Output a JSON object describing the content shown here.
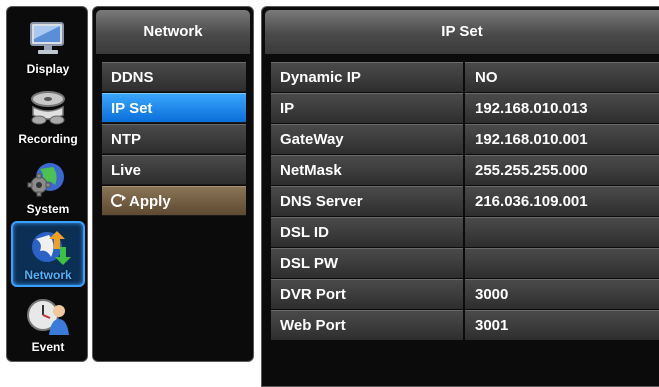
{
  "sidebar": {
    "items": [
      {
        "label": "Display",
        "icon": "monitor-icon"
      },
      {
        "label": "Recording",
        "icon": "film-reel-icon"
      },
      {
        "label": "System",
        "icon": "gear-globe-icon"
      },
      {
        "label": "Network",
        "icon": "network-globe-icon",
        "active": true
      },
      {
        "label": "Event",
        "icon": "clock-person-icon"
      }
    ]
  },
  "menu": {
    "title": "Network",
    "items": [
      {
        "label": "DDNS"
      },
      {
        "label": "IP Set",
        "selected": true
      },
      {
        "label": "NTP"
      },
      {
        "label": "Live"
      },
      {
        "label": "Apply",
        "icon": "refresh-icon"
      }
    ]
  },
  "ipset": {
    "title": "IP Set",
    "rows": [
      {
        "label": "Dynamic IP",
        "value": "NO"
      },
      {
        "label": "IP",
        "value": "192.168.010.013"
      },
      {
        "label": "GateWay",
        "value": "192.168.010.001"
      },
      {
        "label": "NetMask",
        "value": "255.255.255.000"
      },
      {
        "label": "DNS Server",
        "value": "216.036.109.001"
      },
      {
        "label": "DSL ID",
        "value": ""
      },
      {
        "label": "DSL PW",
        "value": ""
      },
      {
        "label": "DVR Port",
        "value": "3000"
      },
      {
        "label": "Web Port",
        "value": "3001"
      }
    ]
  },
  "colors": {
    "selected": "#1a8cf0",
    "apply": "#7a6446",
    "active_border": "#3aa0ff"
  }
}
